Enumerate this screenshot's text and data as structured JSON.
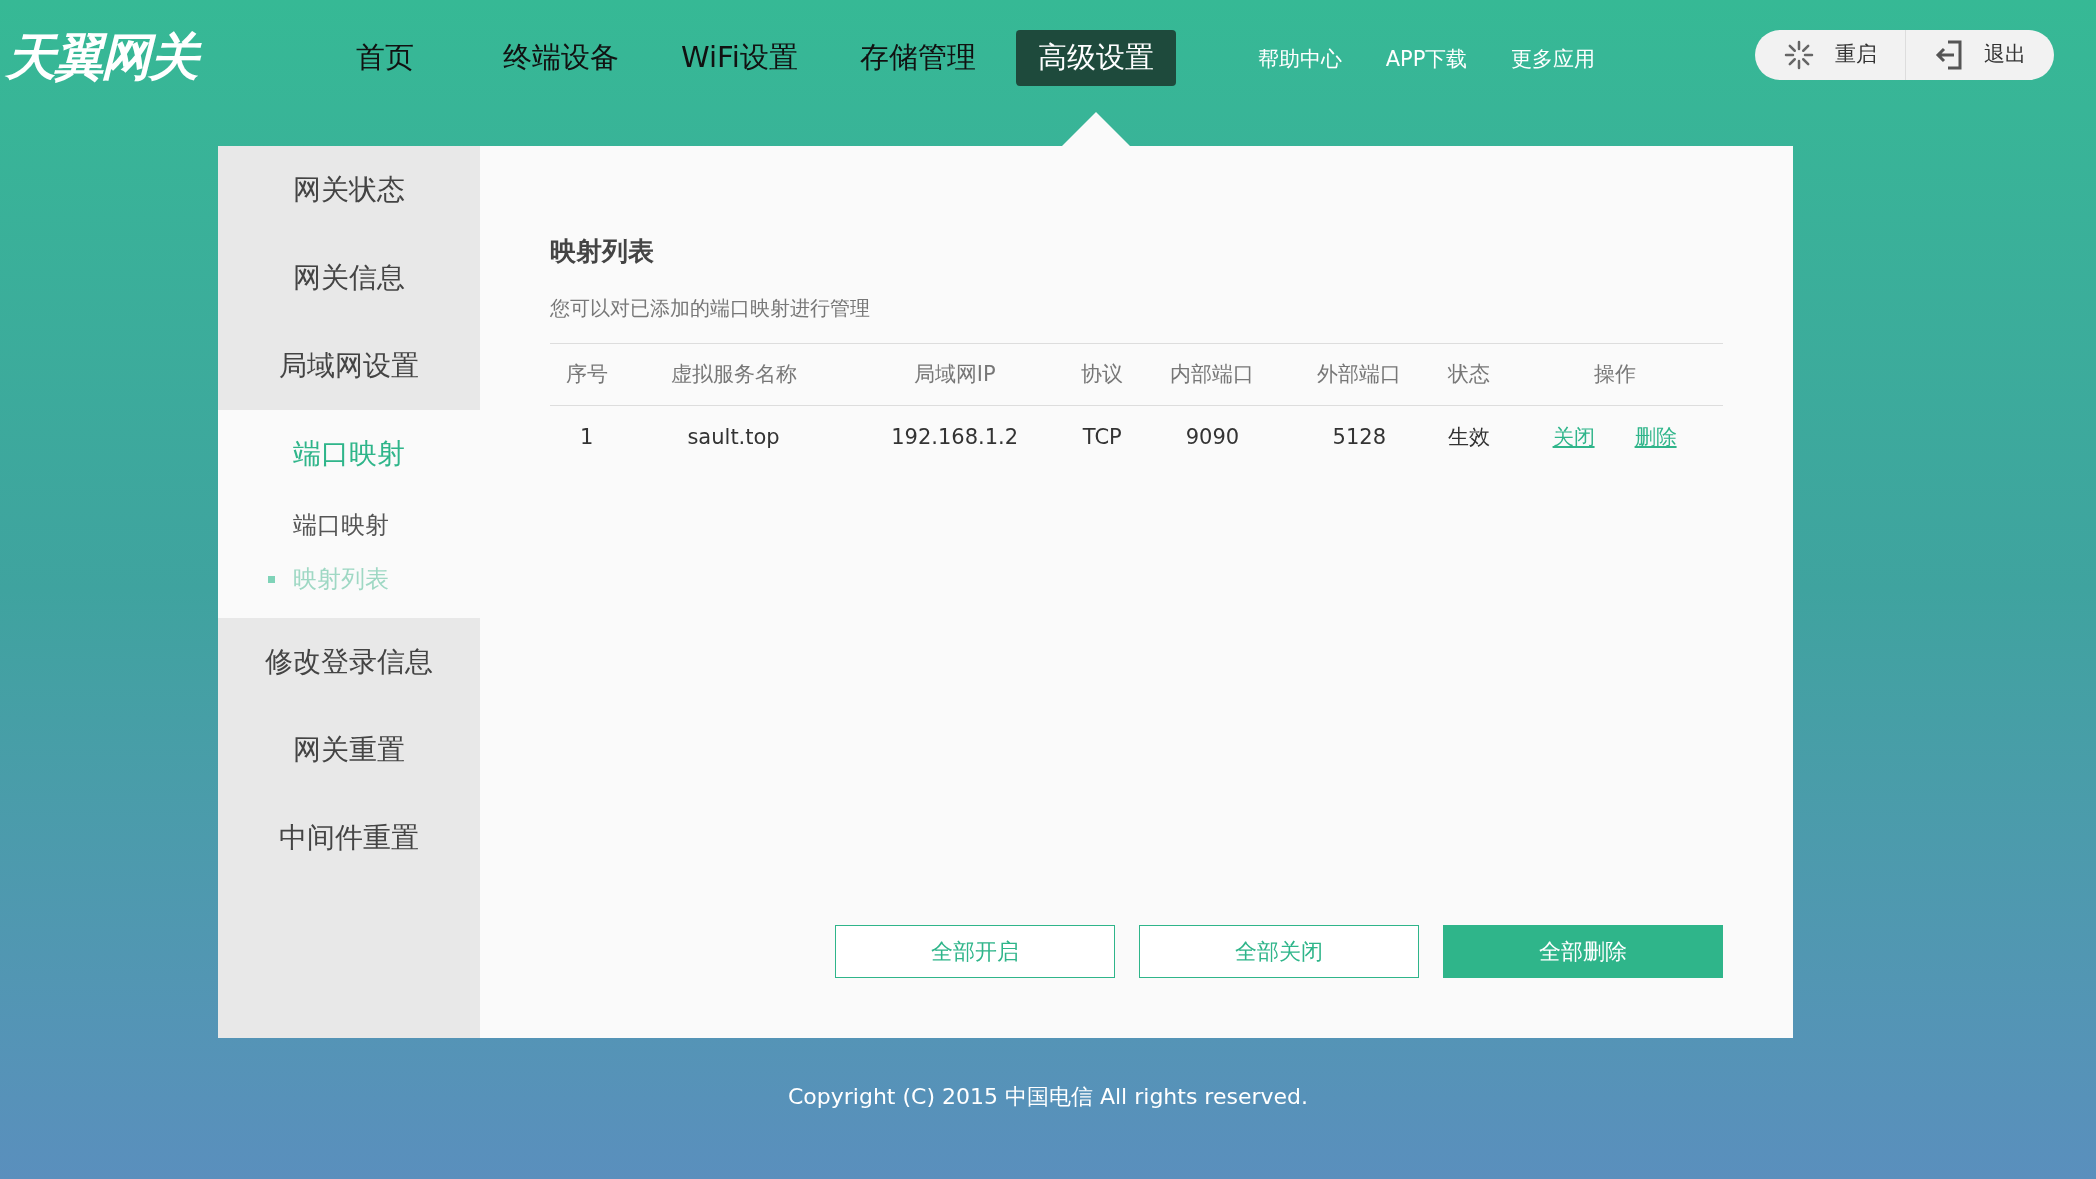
{
  "header": {
    "logo": "天翼网关",
    "nav": [
      {
        "label": "首页",
        "selected": false
      },
      {
        "label": "终端设备",
        "selected": false
      },
      {
        "label": "WiFi设置",
        "selected": false
      },
      {
        "label": "存储管理",
        "selected": false
      },
      {
        "label": "高级设置",
        "selected": true
      }
    ],
    "links": [
      "帮助中心",
      "APP下载",
      "更多应用"
    ],
    "actions": [
      {
        "kind": "restart",
        "label": "重启"
      },
      {
        "kind": "logout",
        "label": "退出"
      }
    ]
  },
  "sidebar": {
    "items": [
      {
        "label": "网关状态",
        "selected": false
      },
      {
        "label": "网关信息",
        "selected": false
      },
      {
        "label": "局域网设置",
        "selected": false
      },
      {
        "label": "端口映射",
        "selected": true,
        "expanded": true,
        "children": [
          {
            "label": "端口映射",
            "selected": false
          },
          {
            "label": "映射列表",
            "selected": true
          }
        ]
      },
      {
        "label": "修改登录信息",
        "selected": false
      },
      {
        "label": "网关重置",
        "selected": false
      },
      {
        "label": "中间件重置",
        "selected": false
      }
    ]
  },
  "content": {
    "title": "映射列表",
    "description": "您可以对已添加的端口映射进行管理",
    "table": {
      "columns": [
        "序号",
        "虚拟服务名称",
        "局域网IP",
        "协议",
        "内部端口",
        "外部端口",
        "状态",
        "操作"
      ],
      "rows": [
        {
          "cells": [
            "1",
            "sault.top",
            "192.168.1.2",
            "TCP",
            "9090",
            "5128",
            "生效"
          ],
          "actions": [
            "关闭",
            "删除"
          ]
        }
      ]
    },
    "buttons": [
      {
        "label": "全部开启",
        "kind": "outline"
      },
      {
        "label": "全部关闭",
        "kind": "outline"
      },
      {
        "label": "全部删除",
        "kind": "filled"
      }
    ]
  },
  "footer": "Copyright (C) 2015 中国电信 All rights reserved."
}
